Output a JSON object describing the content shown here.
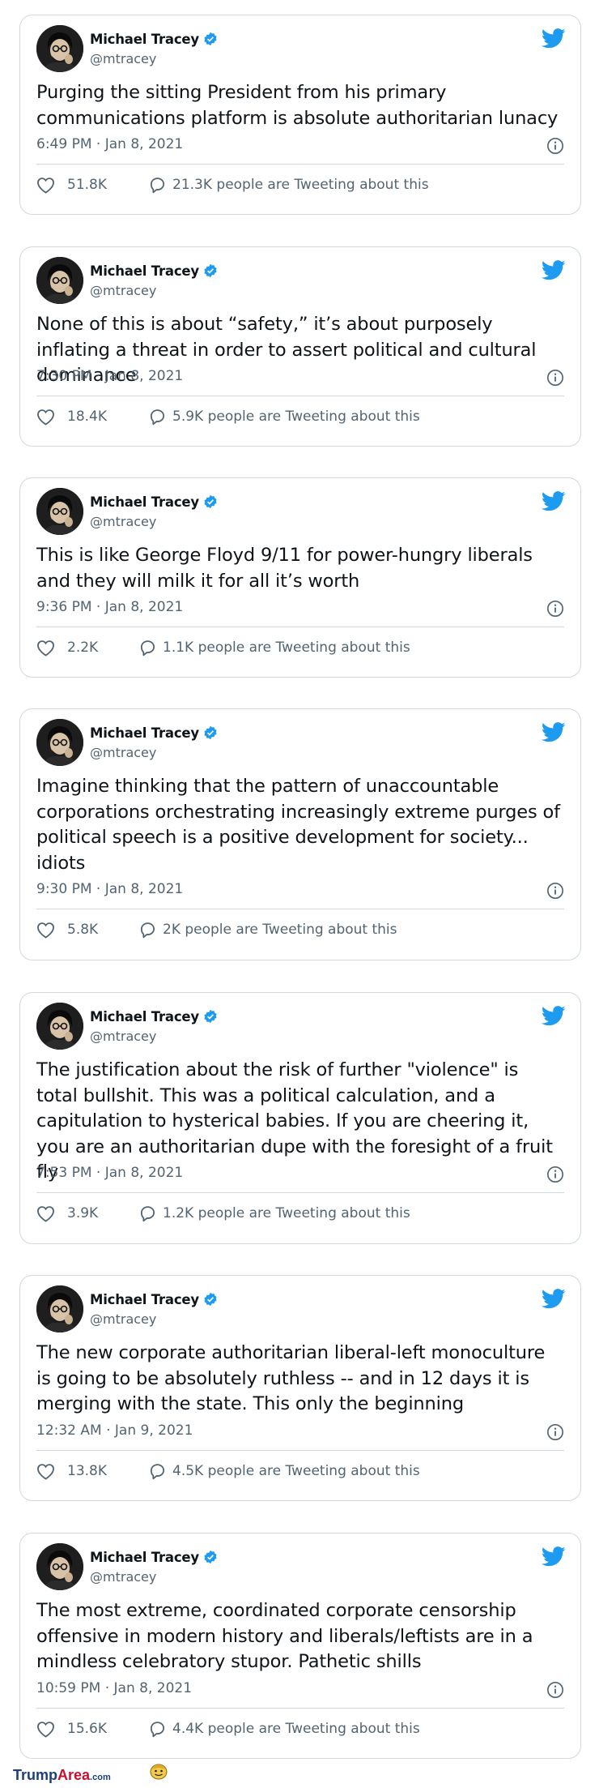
{
  "author": {
    "name": "Michael Tracey",
    "handle": "@mtracey"
  },
  "tweets": [
    {
      "text": "Purging the sitting President from his primary communications platform is absolute authoritarian lunacy",
      "time": "6:49 PM · Jan 8, 2021",
      "likes": "51.8K",
      "talking": "21.3K people are Tweeting about this"
    },
    {
      "text": "None of this is about “safety,” it’s about purposely inflating a threat in order to assert political and cultural dominance",
      "time": "7:30 PM · Jan 8, 2021",
      "likes": "18.4K",
      "talking": "5.9K people are Tweeting about this"
    },
    {
      "text": "This is like George Floyd 9/11 for power-hungry liberals and they will milk it for all it’s worth",
      "time": "9:36 PM · Jan 8, 2021",
      "likes": "2.2K",
      "talking": "1.1K people are Tweeting about this"
    },
    {
      "text": "Imagine thinking that the pattern of unaccountable corporations orchestrating increasingly extreme purges of political speech is a positive development for society... idiots",
      "time": "9:30 PM · Jan 8, 2021",
      "likes": "5.8K",
      "talking": "2K people are Tweeting about this"
    },
    {
      "text": "The justification about the risk of further \"violence\" is total bullshit. This was a political calculation, and a capitulation to hysterical babies. If you are cheering it, you are an authoritarian dupe with the foresight of a fruit fly",
      "time": "7:53 PM · Jan 8, 2021",
      "likes": "3.9K",
      "talking": "1.2K people are Tweeting about this"
    },
    {
      "text": "The new corporate authoritarian liberal-left monoculture is going to be absolutely ruthless -- and in 12 days it is merging with the state. This only the beginning",
      "time": "12:32 AM · Jan 9, 2021",
      "likes": "13.8K",
      "talking": "4.5K people are Tweeting about this"
    },
    {
      "text": "The most extreme, coordinated corporate censorship offensive in modern history and liberals/leftists are in a mindless celebratory stupor. Pathetic shills",
      "time": "10:59 PM · Jan 8, 2021",
      "likes": "15.6K",
      "talking": "4.4K people are Tweeting about this"
    }
  ],
  "watermark": {
    "part1": "Trump",
    "part2": "Area",
    "part3": ".com"
  },
  "colors": {
    "twitter_blue": "#1d9bf0",
    "border": "#cfd9de",
    "muted": "#536471"
  }
}
